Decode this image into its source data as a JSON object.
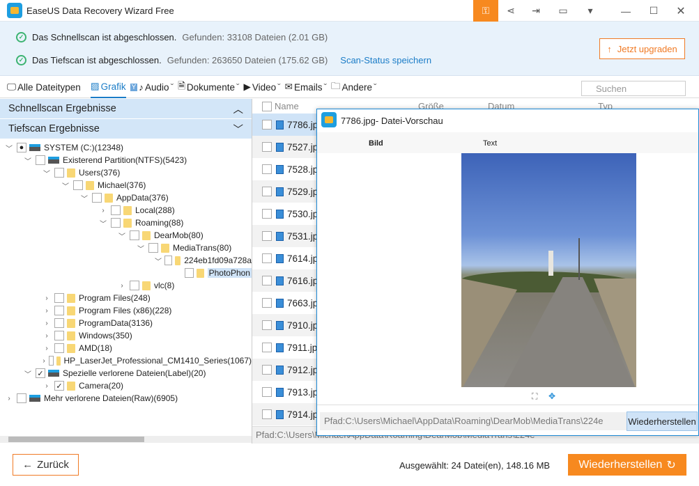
{
  "window": {
    "title": "EaseUS Data Recovery Wizard Free"
  },
  "status": {
    "quick": {
      "text": "Das Schnellscan ist abgeschlossen.",
      "found": "Gefunden: 33108 Dateien (2.01 GB)"
    },
    "deep": {
      "text": "Das Tiefscan ist abgeschlossen.",
      "found": "Gefunden: 263650 Dateien (175.62 GB)"
    },
    "save_link": "Scan-Status speichern",
    "upgrade": "Jetzt upgraden"
  },
  "filters": {
    "items": [
      {
        "label": "Alle Dateitypen"
      },
      {
        "label": "Grafik"
      },
      {
        "label": "Audio"
      },
      {
        "label": "Dokumente"
      },
      {
        "label": "Video"
      },
      {
        "label": "Emails"
      },
      {
        "label": "Andere"
      }
    ],
    "search_placeholder": "Suchen"
  },
  "left": {
    "quick": "Schnellscan Ergebnisse",
    "deep": "Tiefscan Ergebnisse",
    "tree": [
      {
        "label": "SYSTEM (C:)(12348)"
      },
      {
        "label": "Existerend Partition(NTFS)(5423)"
      },
      {
        "label": "Users(376)"
      },
      {
        "label": "Michael(376)"
      },
      {
        "label": "AppData(376)"
      },
      {
        "label": "Local(288)"
      },
      {
        "label": "Roaming(88)"
      },
      {
        "label": "DearMob(80)"
      },
      {
        "label": "MediaTrans(80)"
      },
      {
        "label": "224eb1fd09a728a"
      },
      {
        "label": "PhotoPhon"
      },
      {
        "label": "vlc(8)"
      },
      {
        "label": "Program Files(248)"
      },
      {
        "label": "Program Files (x86)(228)"
      },
      {
        "label": "ProgramData(3136)"
      },
      {
        "label": "Windows(350)"
      },
      {
        "label": "AMD(18)"
      },
      {
        "label": "HP_LaserJet_Professional_CM1410_Series(1067)"
      },
      {
        "label": "Spezielle verlorene Dateien(Label)(20)"
      },
      {
        "label": "Camera(20)"
      },
      {
        "label": "Mehr verlorene Dateien(Raw)(6905)"
      }
    ]
  },
  "list": {
    "columns": [
      "Name",
      "Größe",
      "Datum",
      "Typ"
    ],
    "files": [
      "7786.jpg",
      "7527.jpg",
      "7528.jpg",
      "7529.jpg",
      "7530.jpg",
      "7531.jpg",
      "7614.jpg",
      "7616.jpg",
      "7663.jpg",
      "7910.jpg",
      "7911.jpg",
      "7912.jpg",
      "7913.jpg",
      "7914.jpg"
    ],
    "path": "Pfad:C:\\Users\\Michael\\AppData\\Roaming\\DearMob\\MediaTrans\\224e"
  },
  "preview": {
    "title": "7786.jpg- Datei-Vorschau",
    "tab_image": "Bild",
    "tab_text": "Text",
    "path": "Pfad:C:\\Users\\Michael\\AppData\\Roaming\\DearMob\\MediaTrans\\224e",
    "restore": "Wiederherstellen"
  },
  "footer": {
    "back": "Zurück",
    "selected_prefix": "Ausgewählt: ",
    "selected_count": "24",
    "selected_mid": " Datei(en), ",
    "selected_size": "148.16",
    "selected_unit": " MB",
    "restore": "Wiederherstellen"
  },
  "colors": {
    "accent": "#f7891f",
    "blue": "#1a7cc7",
    "selection": "#cfe3f7"
  }
}
